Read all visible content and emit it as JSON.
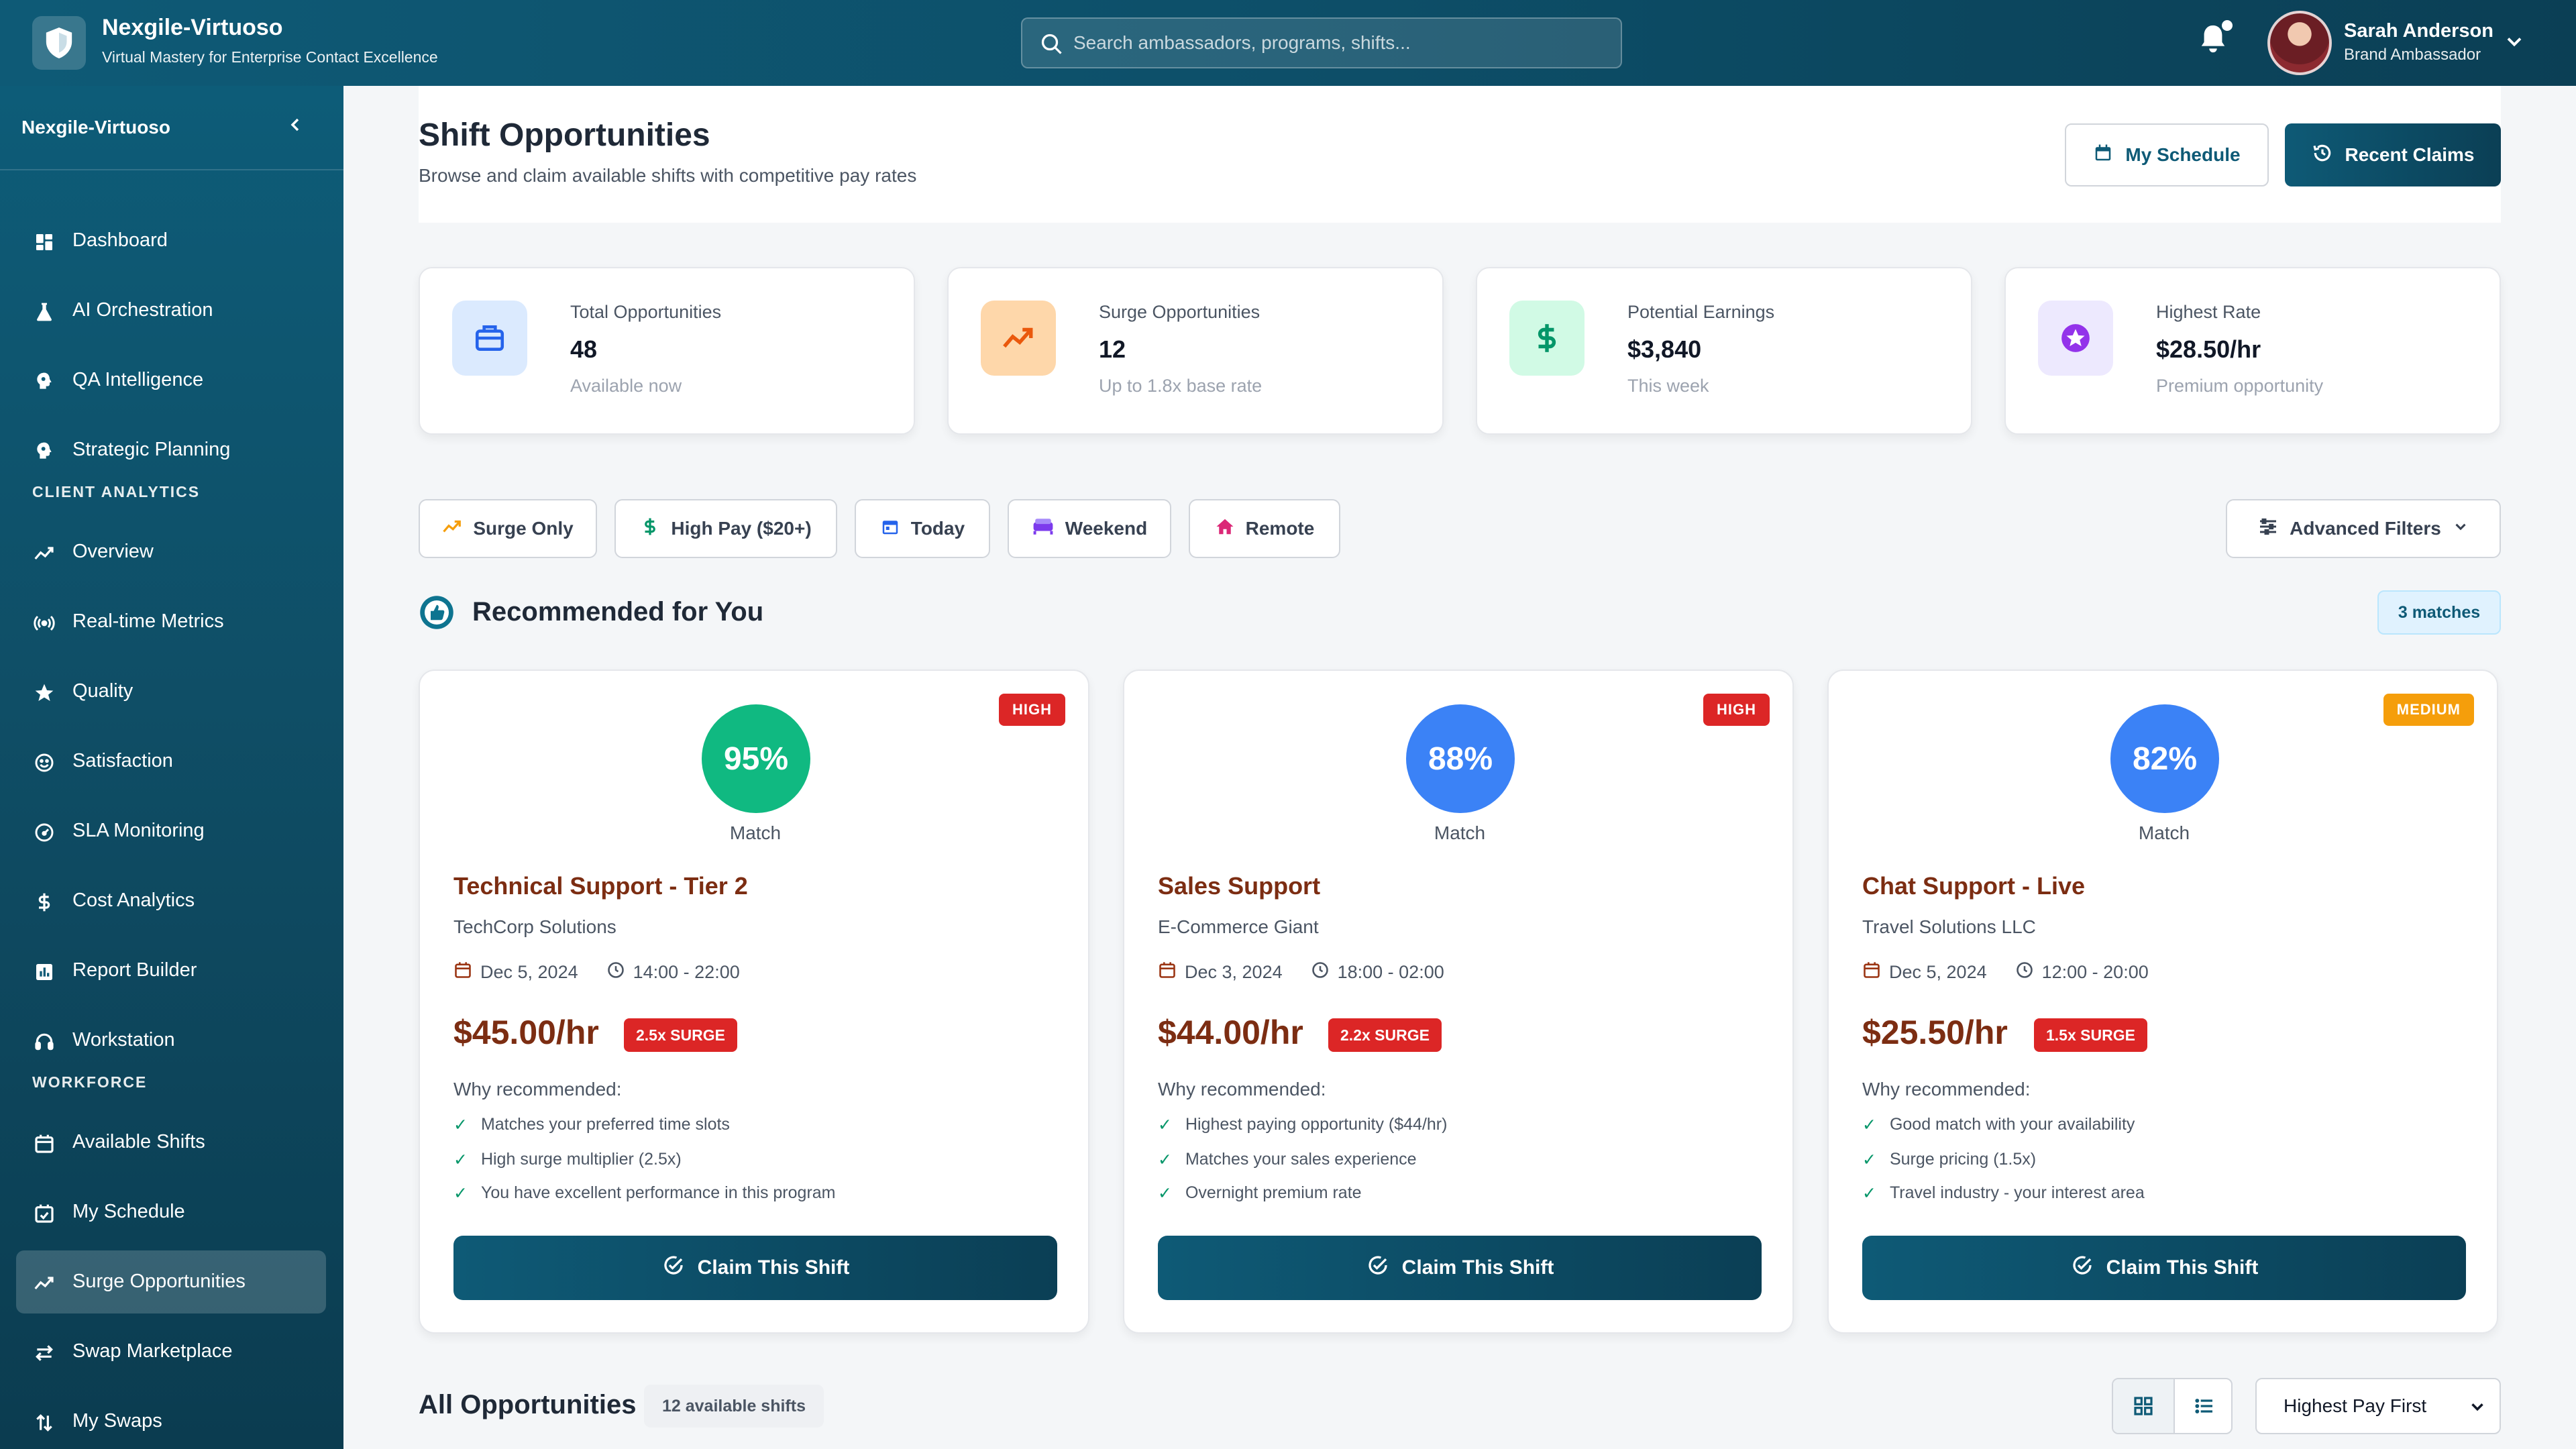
{
  "header": {
    "app_title": "Nexgile-Virtuoso",
    "app_subtitle": "Virtual Mastery for Enterprise Contact Excellence",
    "search_placeholder": "Search ambassadors, programs, shifts...",
    "user_name": "Sarah Anderson",
    "user_role": "Brand Ambassador"
  },
  "sidebar": {
    "title": "Nexgile-Virtuoso",
    "items": [
      {
        "label": "Dashboard",
        "icon": "dashboard-icon"
      },
      {
        "label": "AI Orchestration",
        "icon": "ai-icon"
      },
      {
        "label": "QA Intelligence",
        "icon": "brain-icon"
      },
      {
        "label": "Strategic Planning",
        "icon": "brain-icon"
      }
    ],
    "section_client": "CLIENT ANALYTICS",
    "client_items": [
      {
        "label": "Overview",
        "icon": "trend-icon"
      },
      {
        "label": "Real-time Metrics",
        "icon": "broadcast-icon"
      },
      {
        "label": "Quality",
        "icon": "star-icon"
      },
      {
        "label": "Satisfaction",
        "icon": "smile-icon"
      },
      {
        "label": "SLA Monitoring",
        "icon": "gauge-icon"
      },
      {
        "label": "Cost Analytics",
        "icon": "dollar-icon"
      },
      {
        "label": "Report Builder",
        "icon": "report-icon"
      },
      {
        "label": "Workstation",
        "icon": "headset-icon"
      }
    ],
    "section_workforce": "WORKFORCE",
    "workforce_items": [
      {
        "label": "Available Shifts",
        "icon": "calendar-icon"
      },
      {
        "label": "My Schedule",
        "icon": "calendar-check-icon"
      },
      {
        "label": "Surge Opportunities",
        "icon": "trend-icon",
        "active": true
      },
      {
        "label": "Swap Marketplace",
        "icon": "swap-icon"
      },
      {
        "label": "My Swaps",
        "icon": "swap-vertical-icon"
      }
    ]
  },
  "page": {
    "title": "Shift Opportunities",
    "subtitle": "Browse and claim available shifts with competitive pay rates",
    "my_schedule_label": "My Schedule",
    "recent_claims_label": "Recent Claims"
  },
  "stats": [
    {
      "label": "Total Opportunities",
      "value": "48",
      "sub": "Available now",
      "icon": "briefcase-icon",
      "color": "#2563eb",
      "bg": "#dbeafe"
    },
    {
      "label": "Surge Opportunities",
      "value": "12",
      "sub": "Up to 1.8x base rate",
      "icon": "trend-up-icon",
      "color": "#ea580c",
      "bg": "#fed7aa"
    },
    {
      "label": "Potential Earnings",
      "value": "$3,840",
      "sub": "This week",
      "icon": "dollar-icon",
      "color": "#059669",
      "bg": "#d1fae5"
    },
    {
      "label": "Highest Rate",
      "value": "$28.50/hr",
      "sub": "Premium opportunity",
      "icon": "star-badge-icon",
      "color": "#9333ea",
      "bg": "#ede9fe"
    }
  ],
  "filters": {
    "chips": [
      "Surge Only",
      "High Pay ($20+)",
      "Today",
      "Weekend",
      "Remote"
    ],
    "advanced_label": "Advanced Filters"
  },
  "recommended": {
    "title": "Recommended for You",
    "matches_label": "3 matches",
    "why_label": "Why recommended:",
    "claim_label": "Claim This Shift",
    "match_label": "Match",
    "cards": [
      {
        "priority": "HIGH",
        "priority_color": "#dc2626",
        "match": "95%",
        "match_color": "#10b981",
        "title": "Technical Support - Tier 2",
        "company": "TechCorp Solutions",
        "date": "Dec 5, 2024",
        "time": "14:00 - 22:00",
        "rate": "$45.00/hr",
        "surge": "2.5x SURGE",
        "reasons": [
          "Matches your preferred time slots",
          "High surge multiplier (2.5x)",
          "You have excellent performance in this program"
        ]
      },
      {
        "priority": "HIGH",
        "priority_color": "#dc2626",
        "match": "88%",
        "match_color": "#3b82f6",
        "title": "Sales Support",
        "company": "E-Commerce Giant",
        "date": "Dec 3, 2024",
        "time": "18:00 - 02:00",
        "rate": "$44.00/hr",
        "surge": "2.2x SURGE",
        "reasons": [
          "Highest paying opportunity ($44/hr)",
          "Matches your sales experience",
          "Overnight premium rate"
        ]
      },
      {
        "priority": "MEDIUM",
        "priority_color": "#f59e0b",
        "match": "82%",
        "match_color": "#3b82f6",
        "title": "Chat Support - Live",
        "company": "Travel Solutions LLC",
        "date": "Dec 5, 2024",
        "time": "12:00 - 20:00",
        "rate": "$25.50/hr",
        "surge": "1.5x SURGE",
        "reasons": [
          "Good match with your availability",
          "Surge pricing (1.5x)",
          "Travel industry - your interest area"
        ]
      }
    ]
  },
  "all": {
    "title": "All Opportunities",
    "count_label": "12 available shifts",
    "sort_value": "Highest Pay First"
  }
}
